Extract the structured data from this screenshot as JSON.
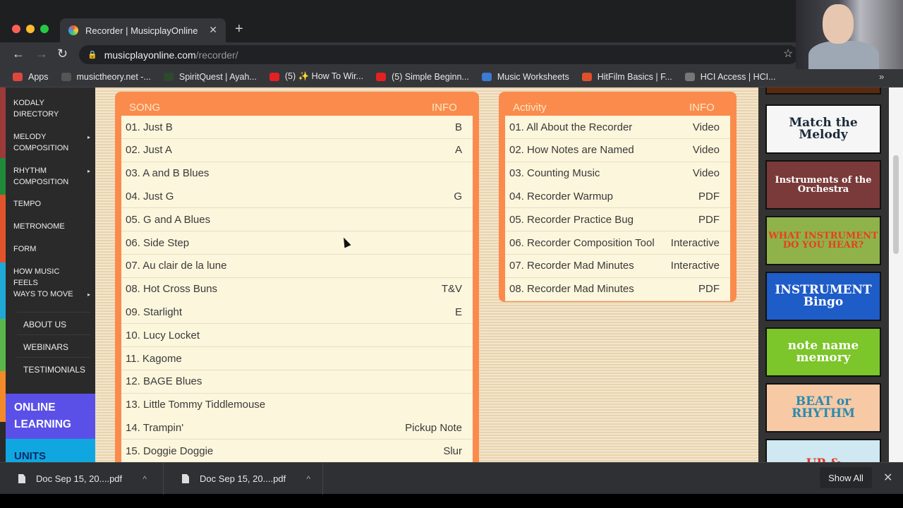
{
  "browser": {
    "tab_title": "Recorder | MusicplayOnline",
    "url_host": "musicplayonline.com",
    "url_path": "/recorder/",
    "bookmarks": [
      {
        "label": "Apps",
        "color": "#e0463c"
      },
      {
        "label": "musictheory.net -...",
        "color": "#555"
      },
      {
        "label": "SpiritQuest | Ayah...",
        "color": "#2d4a2d"
      },
      {
        "label": "(5) ✨ How To Wir...",
        "color": "#e52020"
      },
      {
        "label": "(5) Simple Beginn...",
        "color": "#e52020"
      },
      {
        "label": "Music Worksheets",
        "color": "#3a7bd5"
      },
      {
        "label": "HitFilm Basics | F...",
        "color": "#e0502a"
      },
      {
        "label": "HCI Access | HCI...",
        "color": "#777"
      }
    ]
  },
  "sidebar": {
    "items": [
      {
        "label": "KODALY DIRECTORY",
        "arrow": false
      },
      {
        "label": "MELODY COMPOSITION",
        "arrow": true
      },
      {
        "label": "RHYTHM COMPOSITION",
        "arrow": true
      },
      {
        "label": "TEMPO",
        "arrow": false
      },
      {
        "label": "METRONOME",
        "arrow": false
      },
      {
        "label": "FORM",
        "arrow": false
      },
      {
        "label": "HOW MUSIC FEELS",
        "arrow": false
      },
      {
        "label": "WAYS TO MOVE",
        "arrow": true
      }
    ],
    "sub_items": [
      "ABOUT US",
      "WEBINARS",
      "TESTIMONIALS"
    ],
    "online_learning": "ONLINE LEARNING",
    "units": "UNITS"
  },
  "songs": {
    "header_song": "SONG",
    "header_info": "INFO",
    "rows": [
      [
        "01. Just B",
        "B"
      ],
      [
        "02. Just A",
        "A"
      ],
      [
        "03. A and B Blues",
        ""
      ],
      [
        "04. Just G",
        "G"
      ],
      [
        "05. G and A Blues",
        ""
      ],
      [
        "06. Side Step",
        ""
      ],
      [
        "07. Au clair de la lune",
        ""
      ],
      [
        "08. Hot Cross Buns",
        "T&V"
      ],
      [
        "09. Starlight",
        "E"
      ],
      [
        "10. Lucy Locket",
        ""
      ],
      [
        "11. Kagome",
        ""
      ],
      [
        "12. BAGE Blues",
        ""
      ],
      [
        "13. Little Tommy Tiddlemouse",
        ""
      ],
      [
        "14. Trampin'",
        "Pickup Note"
      ],
      [
        "15. Doggie Doggie",
        "Slur"
      ]
    ]
  },
  "activities": {
    "header_activity": "Activity",
    "header_info": "INFO",
    "rows": [
      [
        "01. All About the Recorder",
        "Video"
      ],
      [
        "02. How Notes are Named",
        "Video"
      ],
      [
        "03. Counting Music",
        "Video"
      ],
      [
        "04. Recorder Warmup",
        "PDF"
      ],
      [
        "05. Recorder Practice Bug",
        "PDF"
      ],
      [
        "06. Recorder Composition Tool",
        "Interactive"
      ],
      [
        "07. Recorder Mad Minutes",
        "Interactive"
      ],
      [
        "08. Recorder Mad Minutes",
        "PDF"
      ]
    ]
  },
  "games": [
    {
      "label": "Match the Melody",
      "bg": "#f6f6f6",
      "fg": "#1a2a3a"
    },
    {
      "label": "Instruments of the Orchestra",
      "bg": "#7a3a3a",
      "fg": "#fff"
    },
    {
      "label": "WHAT INSTRUMENT DO YOU HEAR?",
      "bg": "#8fb24a",
      "fg": "#e8401c"
    },
    {
      "label": "INSTRUMENT Bingo",
      "bg": "#1e5cc8",
      "fg": "#fff"
    },
    {
      "label": "note name memory",
      "bg": "#7cc52a",
      "fg": "#fff"
    },
    {
      "label": "BEAT or RHYTHM",
      "bg": "#f7c9a4",
      "fg": "#2a8ab0"
    },
    {
      "label": "UP &",
      "bg": "#cfe8f2",
      "fg": "#e03a2a"
    }
  ],
  "downloads": {
    "items": [
      "Doc Sep 15, 20....pdf",
      "Doc Sep 15, 20....pdf"
    ],
    "show_all": "Show All"
  }
}
